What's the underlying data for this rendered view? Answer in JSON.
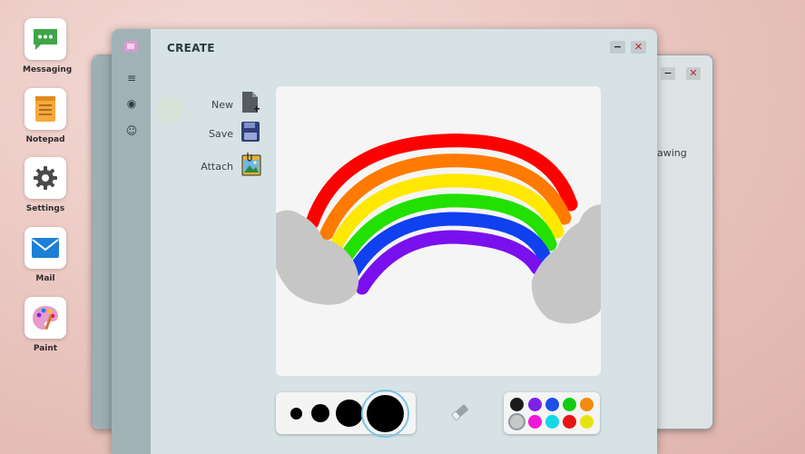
{
  "desktop": {
    "icons": [
      {
        "label": "Messaging",
        "icon": "chat-bubble-icon",
        "color": "#3fa548"
      },
      {
        "label": "Notepad",
        "icon": "notepad-icon",
        "color": "#f2a23a"
      },
      {
        "label": "Settings",
        "icon": "gear-icon",
        "color": "#4a4a4a"
      },
      {
        "label": "Mail",
        "icon": "envelope-icon",
        "color": "#1e7fd6"
      },
      {
        "label": "Paint",
        "icon": "palette-icon",
        "color": "#e2a0c9"
      }
    ]
  },
  "back_window": {
    "minimize": "−",
    "close": "✕",
    "partial_text": "awing"
  },
  "main_window": {
    "title": "CREATE",
    "minimize": "−",
    "close": "✕",
    "sidebar": [
      "menu-icon",
      "palette-icon",
      "face-icon"
    ],
    "sidebar_glyphs": [
      "≡",
      "◉",
      "☺"
    ],
    "actions": [
      {
        "label": "New",
        "icon": "new-file-icon"
      },
      {
        "label": "Save",
        "icon": "floppy-disk-icon"
      },
      {
        "label": "Attach",
        "icon": "image-attach-icon"
      }
    ],
    "brush_sizes": [
      "extra-small",
      "small",
      "medium",
      "large"
    ],
    "selected_brush": "large",
    "eraser": "eraser-icon",
    "palette": [
      "#1b1b1b",
      "#7b22e6",
      "#1e4fe6",
      "#14cc14",
      "#f28a0e",
      "#c8c8c8",
      "#f018d6",
      "#12d8e6",
      "#e61414",
      "#e4e414"
    ],
    "selected_color": "#c8c8c8"
  },
  "drawing": {
    "rainbow_colors": [
      "#ff0000",
      "#ff7a00",
      "#ffe800",
      "#22e000",
      "#1040f0",
      "#7a10ee"
    ],
    "cloud_color": "#c6c6c6"
  }
}
